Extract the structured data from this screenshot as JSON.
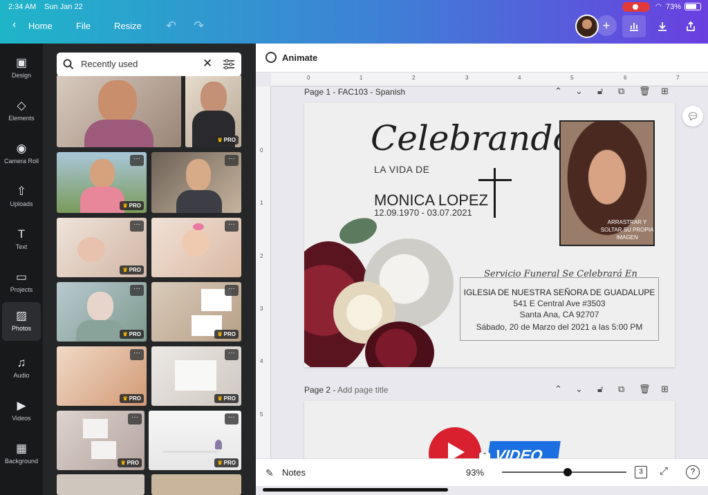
{
  "status": {
    "time": "2:34 AM",
    "date": "Sun Jan 22",
    "battery": "73%"
  },
  "topbar": {
    "home": "Home",
    "file": "File",
    "resize": "Resize"
  },
  "rail": [
    {
      "label": "Design",
      "icon": "design-icon"
    },
    {
      "label": "Elements",
      "icon": "elements-icon"
    },
    {
      "label": "Camera Roll",
      "icon": "camera-icon"
    },
    {
      "label": "Uploads",
      "icon": "upload-icon"
    },
    {
      "label": "Text",
      "icon": "text-icon"
    },
    {
      "label": "Projects",
      "icon": "folder-icon"
    },
    {
      "label": "Photos",
      "icon": "photos-icon"
    },
    {
      "label": "Audio",
      "icon": "audio-icon"
    },
    {
      "label": "Videos",
      "icon": "video-icon"
    },
    {
      "label": "Background",
      "icon": "background-icon"
    }
  ],
  "panel": {
    "search_value": "Recently used",
    "pro_label": "PRO",
    "dots": "···"
  },
  "editor": {
    "animate": "Animate",
    "ruler_h": [
      "0",
      "1",
      "2",
      "3",
      "4",
      "5",
      "6",
      "7"
    ],
    "ruler_v": [
      "0",
      "1",
      "2",
      "3",
      "4",
      "5"
    ],
    "page1_label": "Page 1 - FAC103 - Spanish",
    "page2_label": "Page 2 - ",
    "page2_placeholder": "Add page title"
  },
  "card": {
    "celebrando": "Celebrando",
    "la_vida": "LA VIDA DE",
    "name": "MONICA LOPEZ",
    "dates": "12.09.1970 - 03.07.2021",
    "photo_caption": "ARRASTRAR Y SOLTAR SU PROPIA IMAGEN",
    "service_title": "Servicio Funeral Se Celebrará En",
    "church": "IGLESIA DE NUESTRA SEÑORA DE GUADALUPE",
    "address": "541 E Central Ave #3503",
    "city": "Santa Ana, CA 92707",
    "datetime": "Sábado, 20 de Marzo del 2021 a las 5:00 PM"
  },
  "page2": {
    "video_text": "VIDEO"
  },
  "bottombar": {
    "notes": "Notes",
    "zoom": "93%",
    "zoom_level": 0.53,
    "pages_count": "3",
    "help": "?"
  },
  "colors": {
    "accent_start": "#1fb5c9",
    "accent_end": "#6a3fe0",
    "rail_bg": "#18191b",
    "panel_bg": "#252627"
  }
}
